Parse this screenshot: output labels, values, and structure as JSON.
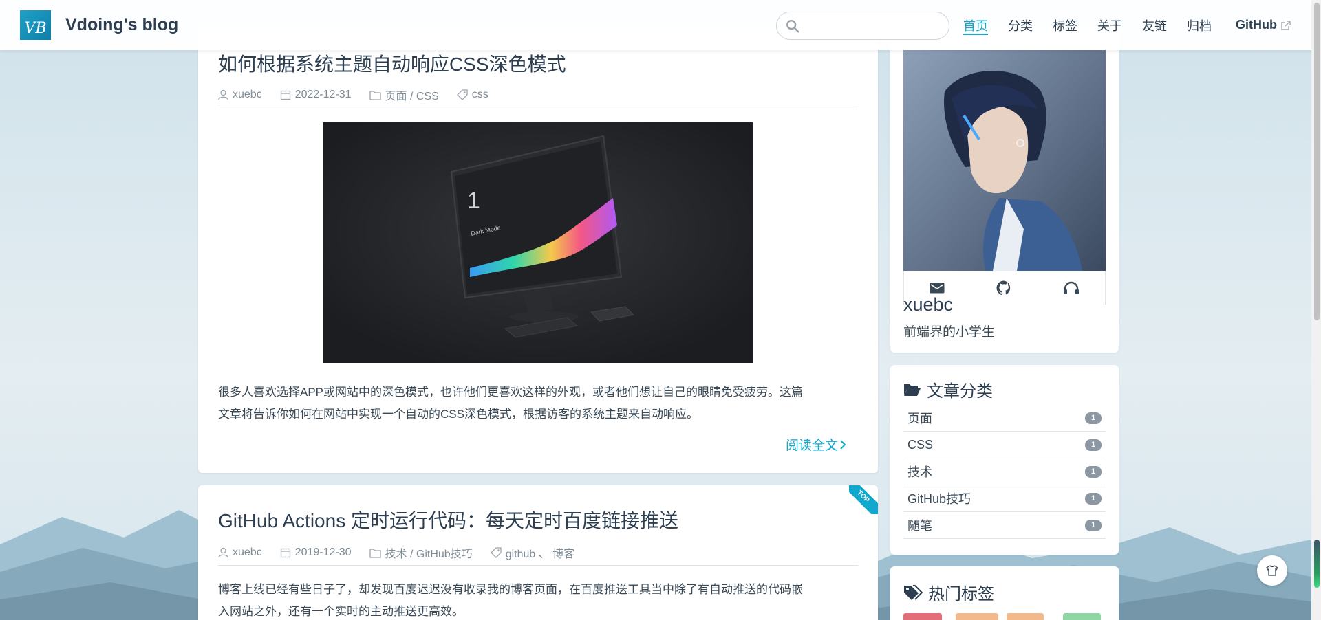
{
  "site": {
    "logo_text": "VB",
    "name": "Vdoing's blog"
  },
  "search": {
    "placeholder": "",
    "value": ""
  },
  "nav": [
    {
      "label": "首页",
      "active": true
    },
    {
      "label": "分类"
    },
    {
      "label": "标签"
    },
    {
      "label": "关于"
    },
    {
      "label": "友链"
    },
    {
      "label": "归档"
    },
    {
      "label": "GitHub",
      "external": true
    }
  ],
  "posts": [
    {
      "title": "如何根据系统主题自动响应CSS深色模式",
      "author": "xuebc",
      "date": "2022-12-31",
      "category": "页面 / CSS",
      "tags": "css",
      "image": {
        "number": "1",
        "label": "Dark Mode"
      },
      "summary_line1": "很多人喜欢选择APP或网站中的深色模式，也许他们更喜欢这样的外观，或者他们想让自己的眼睛免受疲劳。这篇",
      "summary_line2": "文章将告诉你如何在网站中实现一个自动的CSS深色模式，根据访客的系统主题来自动响应。",
      "read_more": "阅读全文"
    },
    {
      "title": "GitHub Actions 定时运行代码：每天定时百度链接推送",
      "badge": "TOP",
      "author": "xuebc",
      "date": "2019-12-30",
      "category": "技术 / GitHub技巧",
      "tags": "github 、 博客",
      "summary_line1": "博客上线已经有些日子了，却发现百度迟迟没有收录我的博客页面，在百度推送工具当中除了有自动推送的代码嵌",
      "summary_line2": "入网站之外，还有一个实时的主动推送更高效。"
    }
  ],
  "profile": {
    "name": "xuebc",
    "description": "前端界的小学生",
    "social_icons": [
      "mail-icon",
      "github-icon",
      "headphones-icon"
    ]
  },
  "categories": {
    "title": "文章分类",
    "items": [
      {
        "name": "页面",
        "count": "1"
      },
      {
        "name": "CSS",
        "count": "1"
      },
      {
        "name": "技术",
        "count": "1"
      },
      {
        "name": "GitHub技巧",
        "count": "1"
      },
      {
        "name": "随笔",
        "count": "1"
      }
    ]
  },
  "hot_tags": {
    "title": "热门标签"
  },
  "colors": {
    "accent": "#11a8cd",
    "text": "#2c3e50",
    "badge": "#8b98a3"
  }
}
